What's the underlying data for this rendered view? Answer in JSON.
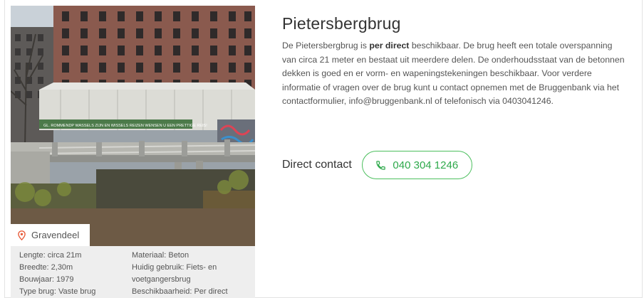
{
  "bridge": {
    "title": "Pietersbergbrug",
    "desc_part1": "De Pietersbergbrug is ",
    "desc_bold": "per direct",
    "desc_part2": " beschikbaar. De brug heeft een totale overspanning van circa 21 meter en bestaat uit meerdere delen.  De onderhoudsstaat van de betonnen dekken is goed en er vorm- en wapeningstekeningen beschikbaar. Voor verdere informatie of vragen over de brug kunt u contact opnemen met de Bruggenbank via het contactformulier, info@bruggenbank.nl of telefonisch via 0403041246."
  },
  "location": {
    "label": "Gravendeel",
    "icon": "map-pin-icon",
    "icon_color": "#e85c3a"
  },
  "photo": {
    "banner_text": "GL. ROMMENDP WASSELS ZIJN EN WISSELS REIZEN WENSEN U EEN PRETTIGE REIS!"
  },
  "specs": {
    "left": [
      "Lengte: circa 21m",
      "Breedte: 2,30m",
      "Bouwjaar: 1979",
      "Type brug: Vaste brug"
    ],
    "right": [
      "Materiaal: Beton",
      "Huidig gebruik: Fiets- en",
      "voetgangersbrug",
      "Beschikbaarheid: Per direct"
    ]
  },
  "contact": {
    "label": "Direct contact",
    "phone": "040 304 1246",
    "icon": "phone-icon",
    "accent": "#2ea94b"
  }
}
